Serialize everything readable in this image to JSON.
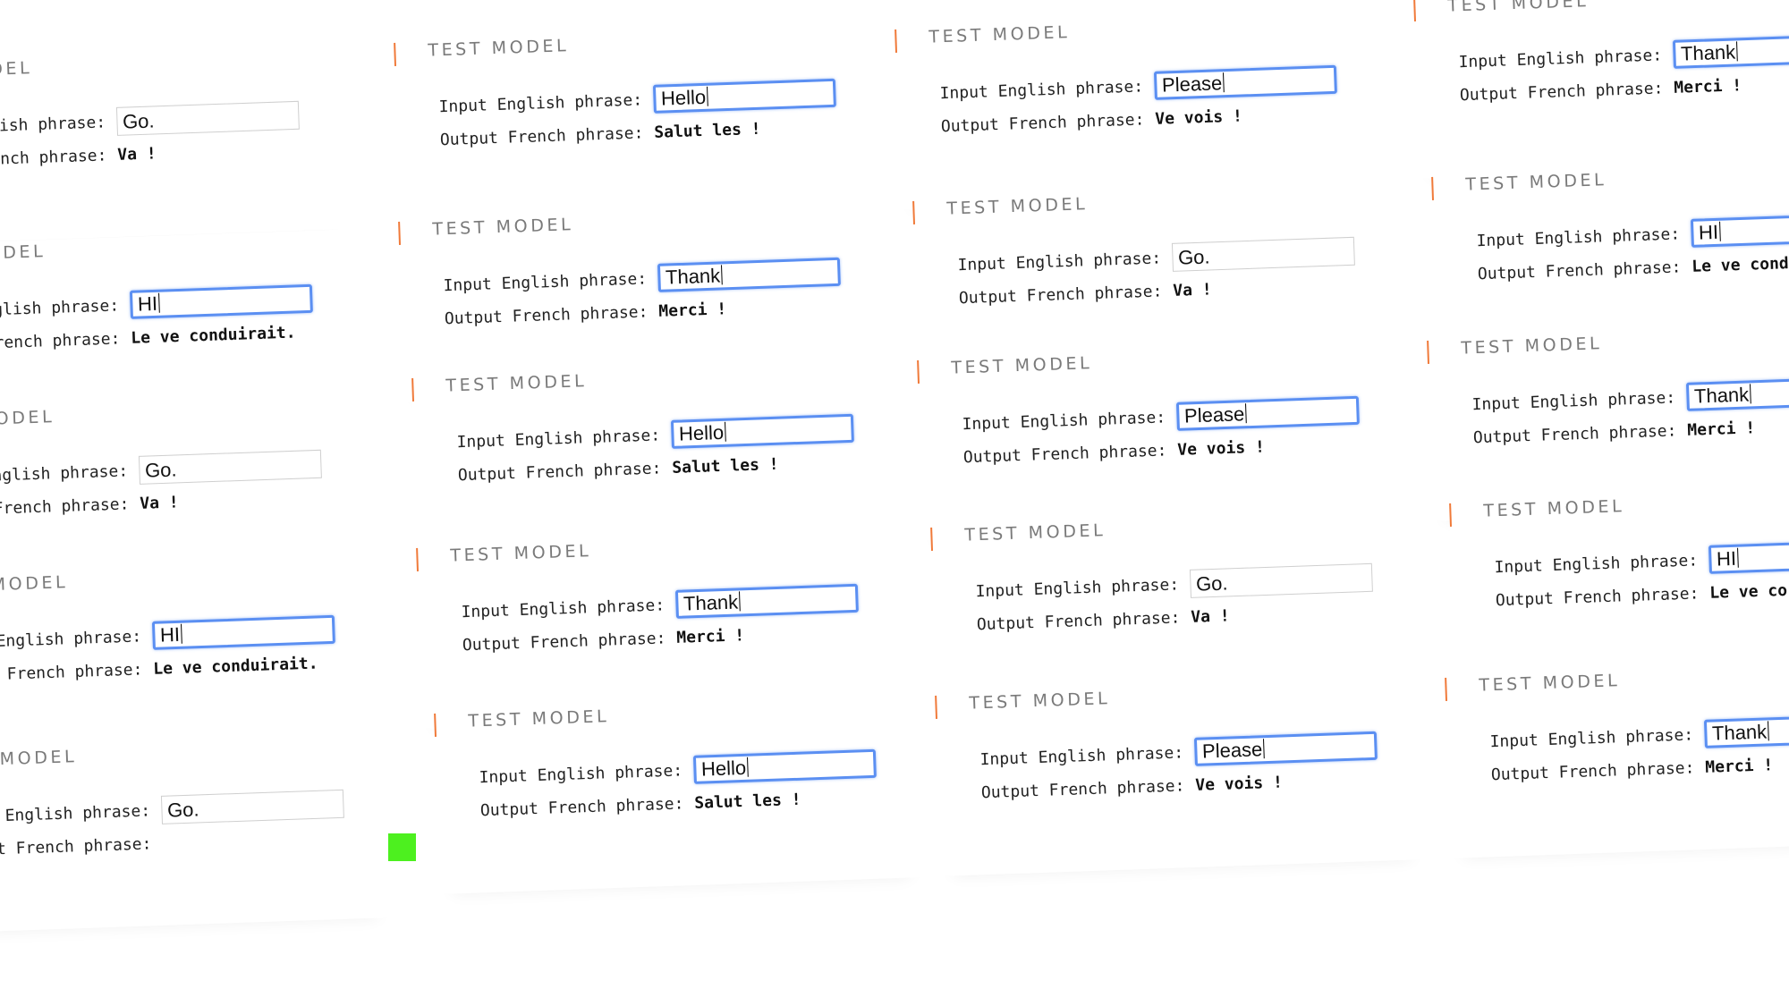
{
  "cards": [
    {
      "title": "TEST MODEL",
      "input_label": "Input English phrase:",
      "input_value": "Go.",
      "output_label": "Output French phrase:",
      "output_value": "Va !",
      "focused": false
    },
    {
      "title": "TEST MODEL",
      "input_label": "Input English phrase:",
      "input_value": "HI",
      "output_label": "Output French phrase:",
      "output_value": "Le ve conduirait.",
      "focused": true
    },
    {
      "title": "TEST MODEL",
      "input_label": "Input English phrase:",
      "input_value": "Go.",
      "output_label": "Output French phrase:",
      "output_value": "Va !",
      "focused": false
    },
    {
      "title": "TEST MODEL",
      "input_label": "Input English phrase:",
      "input_value": "HI",
      "output_label": "Output French phrase:",
      "output_value": "Le ve conduirait.",
      "focused": true
    },
    {
      "title": "TEST MODEL",
      "input_label": "Input English phrase:",
      "input_value": "Go.",
      "output_label": "Output French phrase:",
      "output_value": "",
      "focused": false
    },
    {
      "title": "TEST MODEL",
      "input_label": "Input English phrase:",
      "input_value": "Hello",
      "output_label": "Output French phrase:",
      "output_value": "Salut les !",
      "focused": true
    },
    {
      "title": "TEST MODEL",
      "input_label": "Input English phrase:",
      "input_value": "Thank",
      "output_label": "Output French phrase:",
      "output_value": "Merci !",
      "focused": true
    },
    {
      "title": "TEST MODEL",
      "input_label": "Input English phrase:",
      "input_value": "Hello",
      "output_label": "Output French phrase:",
      "output_value": "Salut les !",
      "focused": true
    },
    {
      "title": "TEST MODEL",
      "input_label": "Input English phrase:",
      "input_value": "Thank",
      "output_label": "Output French phrase:",
      "output_value": "Merci !",
      "focused": true
    },
    {
      "title": "TEST MODEL",
      "input_label": "Input English phrase:",
      "input_value": "Hello",
      "output_label": "Output French phrase:",
      "output_value": "Salut les !",
      "focused": true
    },
    {
      "title": "TEST MODEL",
      "input_label": "Input English phrase:",
      "input_value": "Please",
      "output_label": "Output French phrase:",
      "output_value": "Ve vois !",
      "focused": true
    },
    {
      "title": "TEST MODEL",
      "input_label": "Input English phrase:",
      "input_value": "Go.",
      "output_label": "Output French phrase:",
      "output_value": "Va !",
      "focused": false
    },
    {
      "title": "TEST MODEL",
      "input_label": "Input English phrase:",
      "input_value": "Please",
      "output_label": "Output French phrase:",
      "output_value": "Ve vois !",
      "focused": true
    },
    {
      "title": "TEST MODEL",
      "input_label": "Input English phrase:",
      "input_value": "Go.",
      "output_label": "Output French phrase:",
      "output_value": "Va !",
      "focused": false
    },
    {
      "title": "TEST MODEL",
      "input_label": "Input English phrase:",
      "input_value": "Please",
      "output_label": "Output French phrase:",
      "output_value": "Ve vois !",
      "focused": true
    },
    {
      "title": "TEST MODEL",
      "input_label": "Input English phrase:",
      "input_value": "Thank",
      "output_label": "Output French phrase:",
      "output_value": "Merci !",
      "focused": true
    },
    {
      "title": "TEST MODEL",
      "input_label": "Input English phrase:",
      "input_value": "HI",
      "output_label": "Output French phrase:",
      "output_value": "Le ve condu",
      "focused": true
    },
    {
      "title": "TEST MODEL",
      "input_label": "Input English phrase:",
      "input_value": "Thank",
      "output_label": "Output French phrase:",
      "output_value": "Merci !",
      "focused": true
    },
    {
      "title": "TEST MODEL",
      "input_label": "Input English phrase:",
      "input_value": "HI",
      "output_label": "Output French phrase:",
      "output_value": "Le ve co",
      "focused": true
    },
    {
      "title": "TEST MODEL",
      "input_label": "Input English phrase:",
      "input_value": "Thank",
      "output_label": "Output French phrase:",
      "output_value": "Merci !",
      "focused": true
    }
  ],
  "colors": {
    "accent": "#f07a3a",
    "focus_ring": "#5b8ff2",
    "marker": "#4df01f"
  }
}
